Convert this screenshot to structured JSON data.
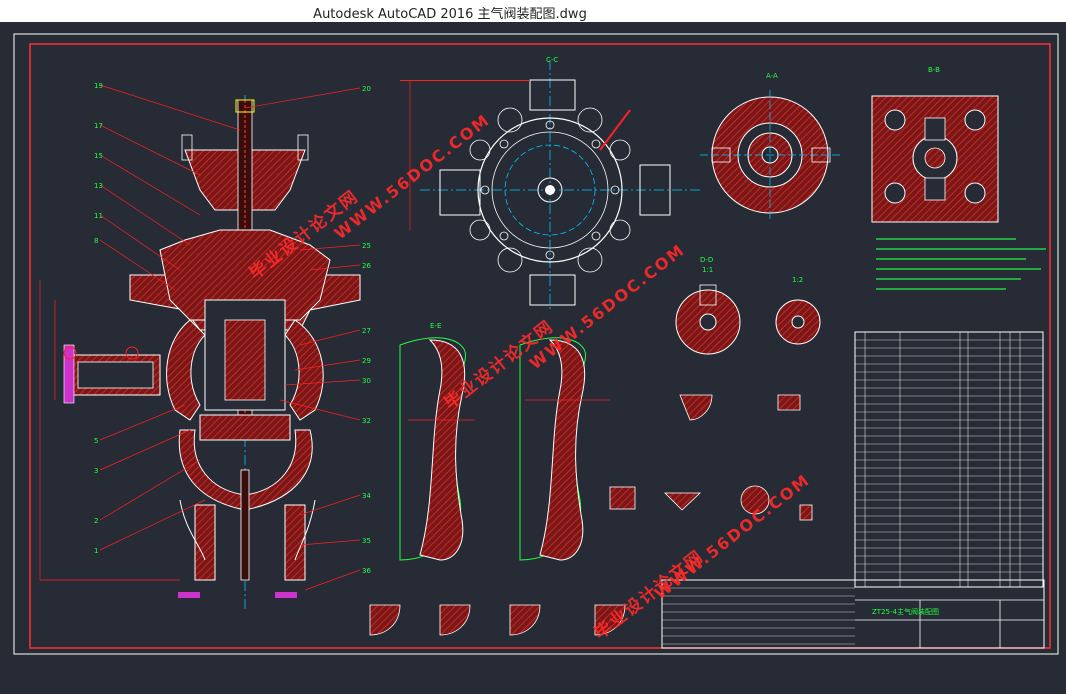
{
  "window": {
    "title": "Autodesk AutoCAD 2016    主气阀装配图.dwg"
  },
  "views": {
    "section_aa": "A-A",
    "section_bb": "B-B",
    "section_cc": "C-C",
    "section_ee": "E-E",
    "section_dd": "D-D",
    "scale_11": "1:1",
    "scale_12": "1:2"
  },
  "watermarks": [
    {
      "text": "WWW.56DOC.COM"
    },
    {
      "text": "毕业设计论文网"
    }
  ],
  "title_block": {
    "drawing_name": "ZT25-4主气阀装配图"
  },
  "colors": {
    "background": "#262b35",
    "frame": "#ff3030",
    "outline": "#ffffff",
    "hatch": "#b02020",
    "centerline": "#00c8ff",
    "annotation": "#22ff44",
    "leader": "#ff2020"
  }
}
